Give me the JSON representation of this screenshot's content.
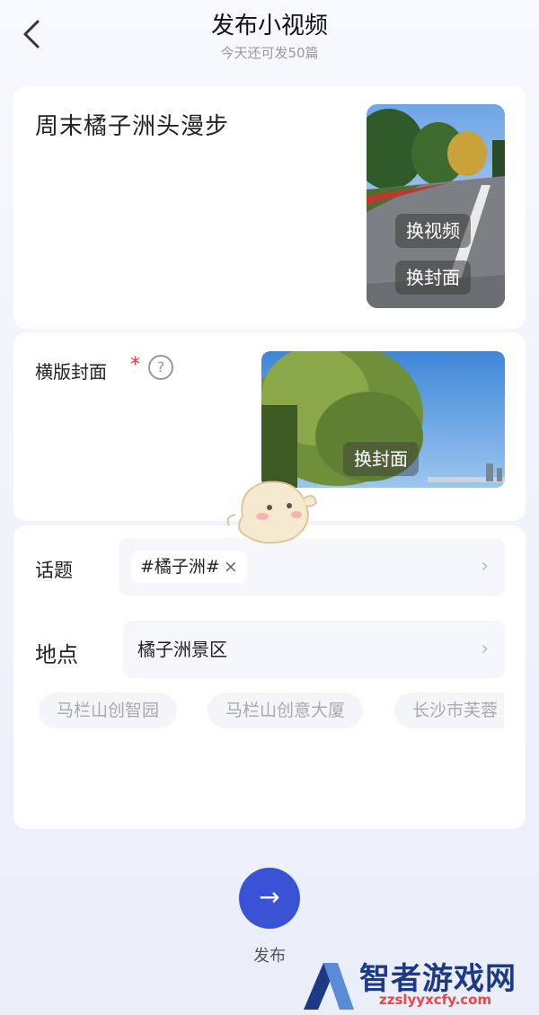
{
  "header": {
    "title": "发布小视频",
    "subtitle": "今天还可发50篇"
  },
  "post": {
    "title": "周末橘子洲头漫步",
    "change_video_label": "换视频",
    "change_cover_label": "换封面"
  },
  "landscape_cover": {
    "label": "横版封面",
    "required_mark": "*",
    "help_glyph": "?",
    "change_cover_label": "换封面"
  },
  "topic": {
    "label": "话题",
    "chip_text": "#橘子洲#",
    "chip_close": "×",
    "chevron": "›"
  },
  "location": {
    "label": "地点",
    "value": "橘子洲景区",
    "chevron": "›",
    "suggestions": [
      "马栏山创智园",
      "马栏山创意大厦",
      "长沙市芙蓉"
    ]
  },
  "publish": {
    "icon_glyph": "→",
    "label": "发布"
  },
  "watermark": {
    "text": "智者游戏网",
    "sub": "zzslyyxcfy.com"
  },
  "colors": {
    "accent": "#3952d6",
    "required": "#e43c3c"
  }
}
